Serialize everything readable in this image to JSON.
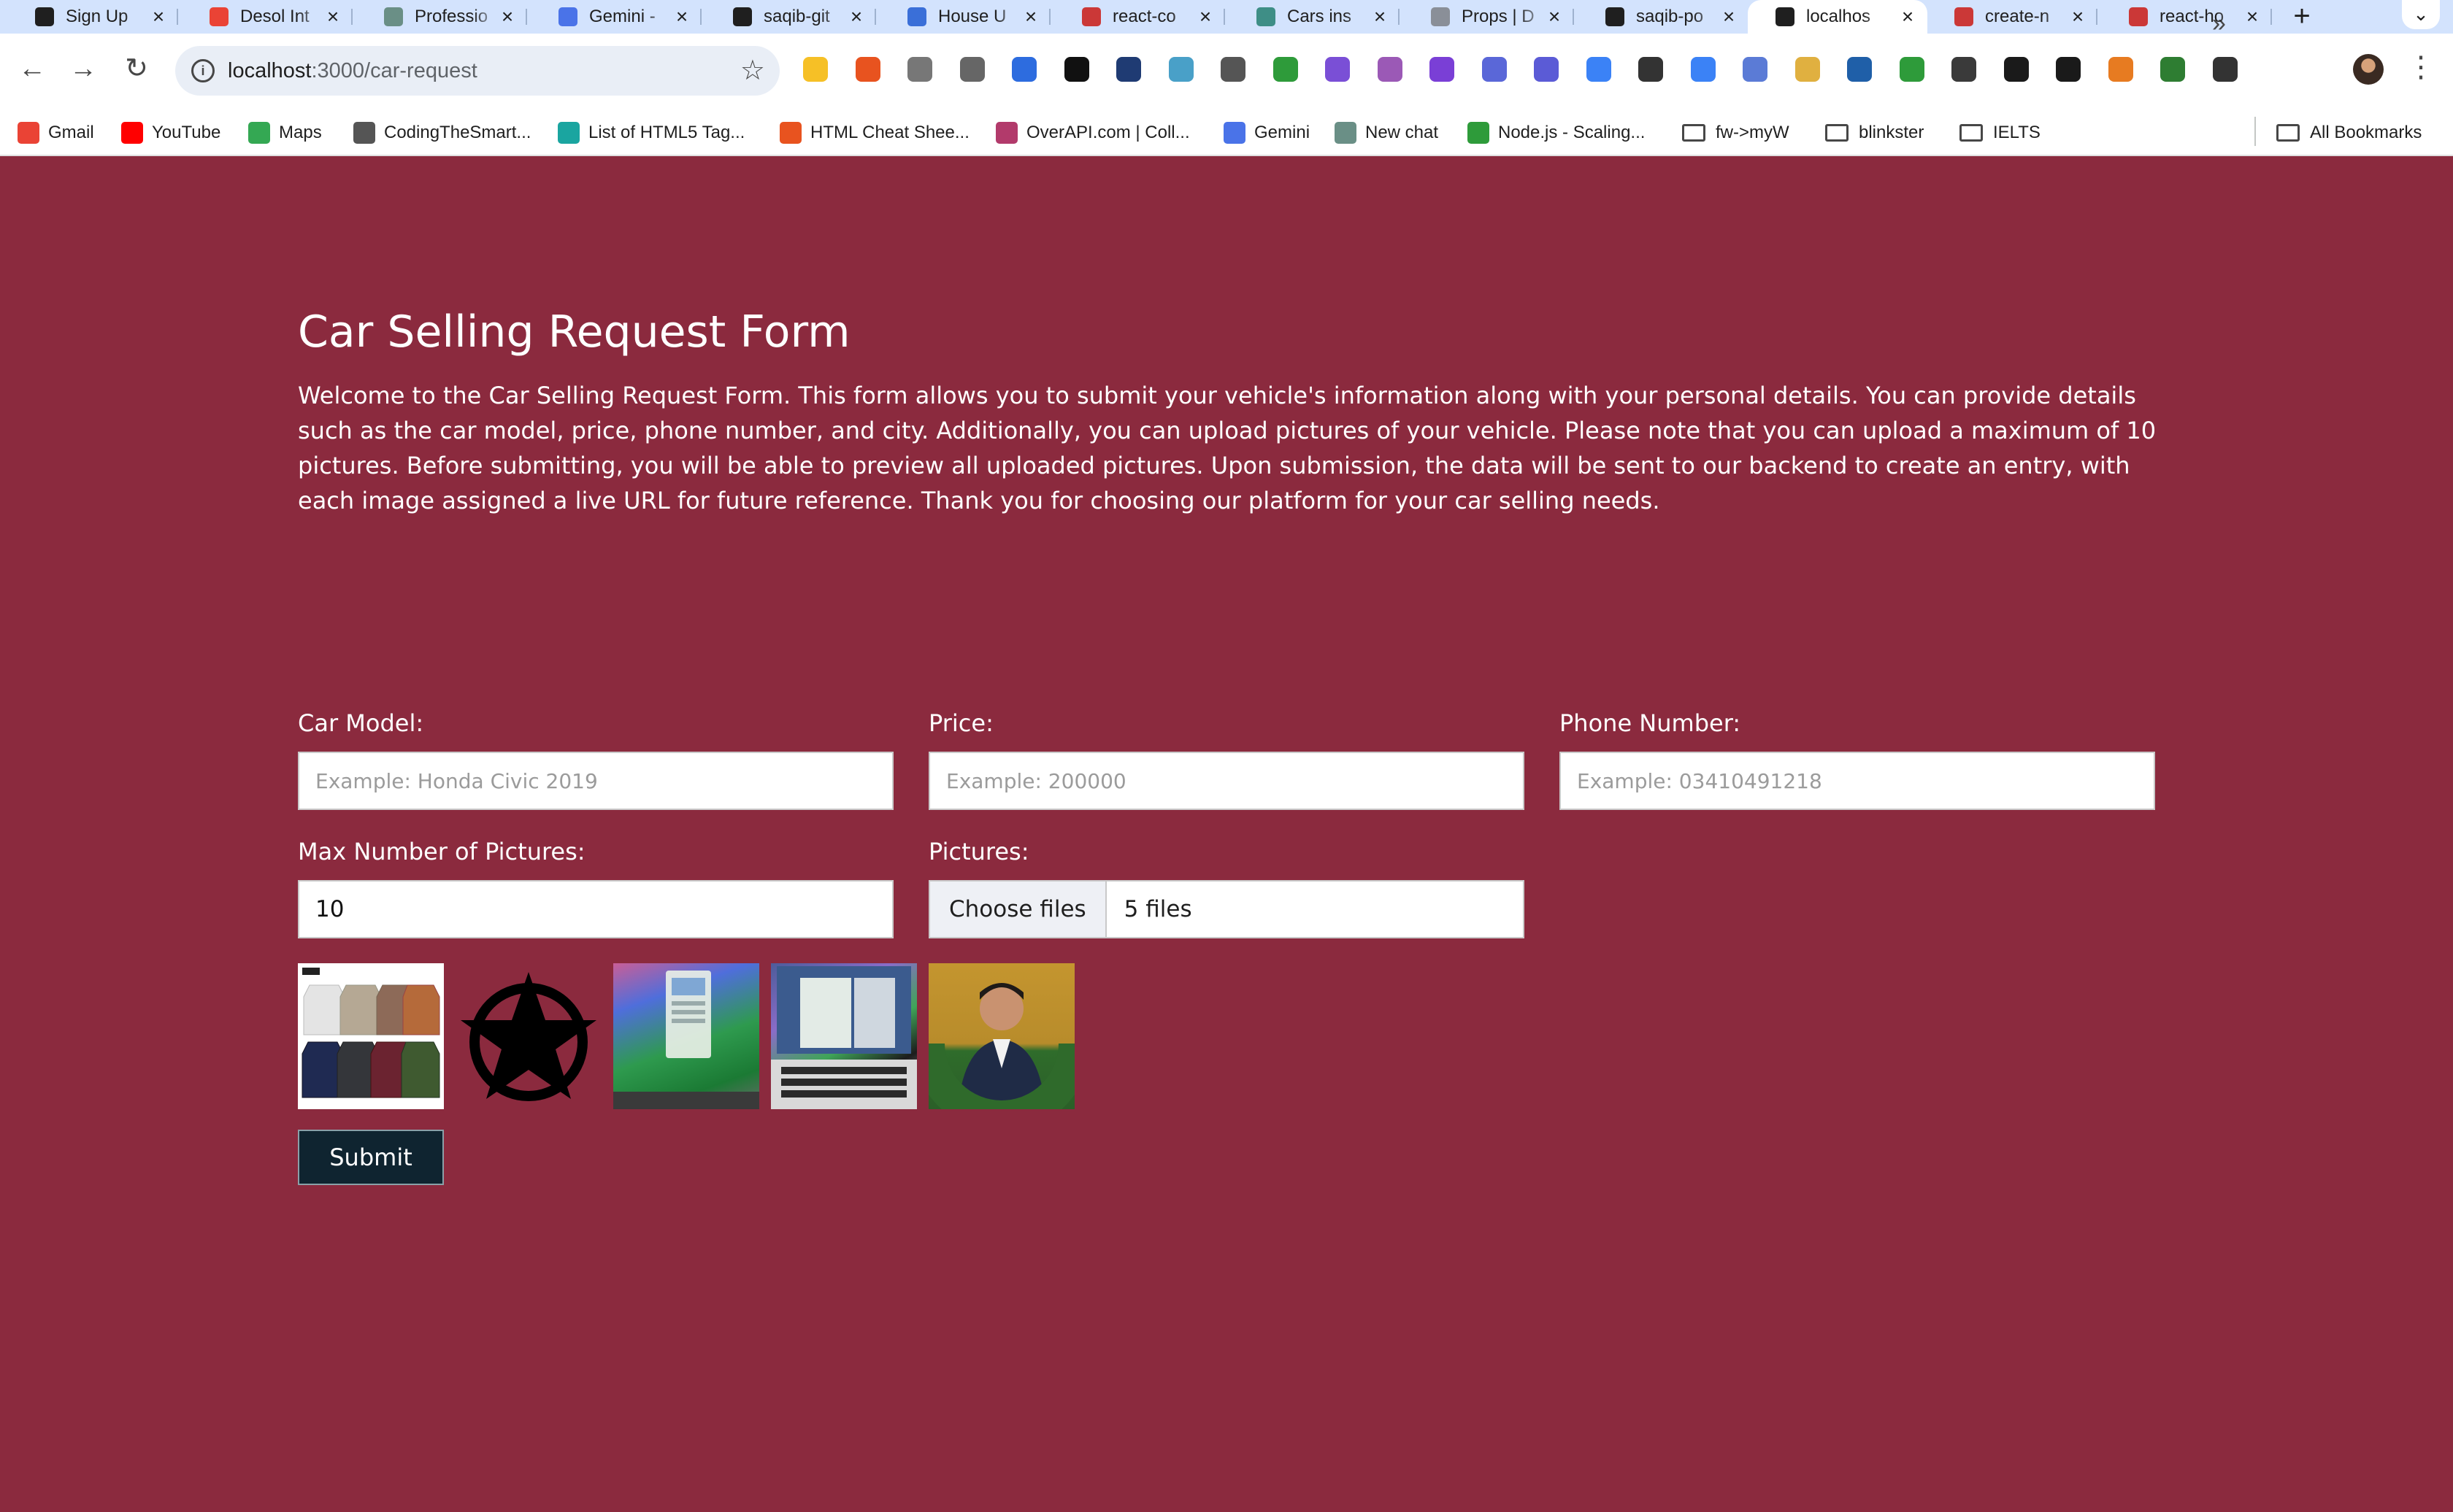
{
  "browser": {
    "tabs": [
      {
        "title": "Sign Up",
        "favicon": "github-dark-circle",
        "color": "#1f1f1f"
      },
      {
        "title": "Desol Int",
        "favicon": "gmail-icon",
        "color": "#ea4335"
      },
      {
        "title": "Professio",
        "favicon": "chatgpt-icon",
        "color": "#6a8f86"
      },
      {
        "title": "Gemini -",
        "favicon": "gemini-icon",
        "color": "#4a73e8"
      },
      {
        "title": "saqib-git",
        "favicon": "github-icon",
        "color": "#1f1f1f"
      },
      {
        "title": "House U",
        "favicon": "flag-icon",
        "color": "#3a6fd8"
      },
      {
        "title": "react-co",
        "favicon": "npm-icon",
        "color": "#cb3837"
      },
      {
        "title": "Cars ins",
        "favicon": "document-icon",
        "color": "#3e8e86"
      },
      {
        "title": "Props | D",
        "favicon": "globe-icon",
        "color": "#8a8f98"
      },
      {
        "title": "saqib-po",
        "favicon": "vercel-icon",
        "color": "#1f1f1f"
      },
      {
        "title": "localhos",
        "favicon": "vercel-icon",
        "color": "#1f1f1f",
        "active": true
      },
      {
        "title": "create-n",
        "favicon": "npm-icon",
        "color": "#cb3837"
      },
      {
        "title": "react-ho",
        "favicon": "npm-icon",
        "color": "#cb3837"
      }
    ],
    "new_tab_symbol": "+",
    "tab_search_symbol": "⌄",
    "url_host": "localhost",
    "url_path": ":3000/car-request",
    "bookmarks": [
      {
        "label": "Gmail",
        "icon": "gmail-icon",
        "color": "#ea4335"
      },
      {
        "label": "YouTube",
        "icon": "youtube-icon",
        "color": "#ff0000"
      },
      {
        "label": "Maps",
        "icon": "maps-icon",
        "color": "#34a853"
      },
      {
        "label": "CodingTheSmart...",
        "icon": "coding-icon",
        "color": "#555555"
      },
      {
        "label": "List of HTML5 Tag...",
        "icon": "hexagon-icon",
        "color": "#1aa5a0"
      },
      {
        "label": "HTML Cheat Shee...",
        "icon": "sr-icon",
        "color": "#e8531f"
      },
      {
        "label": "OverAPI.com | Coll...",
        "icon": "overapi-icon",
        "color": "#b23a6b"
      },
      {
        "label": "Gemini",
        "icon": "gemini-icon",
        "color": "#4a73e8"
      },
      {
        "label": "New chat",
        "icon": "chatgpt-icon",
        "color": "#6a8f86"
      },
      {
        "label": "Node.js - Scaling...",
        "icon": "node-icon",
        "color": "#2e9b3a"
      },
      {
        "label": "fw->myW",
        "icon": "folder-icon",
        "color": "#474747"
      },
      {
        "label": "blinkster",
        "icon": "folder-icon",
        "color": "#474747"
      },
      {
        "label": "IELTS",
        "icon": "folder-icon",
        "color": "#474747"
      }
    ],
    "more_bookmarks": "»",
    "all_bookmarks": "All Bookmarks"
  },
  "form": {
    "title": "Car Selling Request Form",
    "intro": "Welcome to the Car Selling Request Form. This form allows you to submit your vehicle's information along with your personal details. You can provide details such as the car model, price, phone number, and city. Additionally, you can upload pictures of your vehicle. Please note that you can upload a maximum of 10 pictures. Before submitting, you will be able to preview all uploaded pictures. Upon submission, the data will be sent to our backend to create an entry, with each image assigned a live URL for future reference. Thank you for choosing our platform for your car selling needs.",
    "car_model": {
      "label": "Car Model:",
      "placeholder": "Example: Honda Civic 2019",
      "value": ""
    },
    "price": {
      "label": "Price:",
      "placeholder": "Example: 200000",
      "value": ""
    },
    "phone": {
      "label": "Phone Number:",
      "placeholder": "Example: 03410491218",
      "value": ""
    },
    "max_pictures": {
      "label": "Max Number of Pictures:",
      "value": "10"
    },
    "pictures": {
      "label": "Pictures:",
      "button": "Choose files",
      "status": "5 files"
    },
    "previews": [
      {
        "name": "jackets-photo"
      },
      {
        "name": "black-star-logo"
      },
      {
        "name": "laptop-screen-photo"
      },
      {
        "name": "laptop-keyboard-photo"
      },
      {
        "name": "profile-photo",
        "badge_text": "#OPENTOWORK"
      }
    ],
    "submit": "Submit"
  },
  "colors": {
    "page_background": "#8b2a3e",
    "submit_background": "#0f2430",
    "tabstrip": "#d3e3fd"
  }
}
